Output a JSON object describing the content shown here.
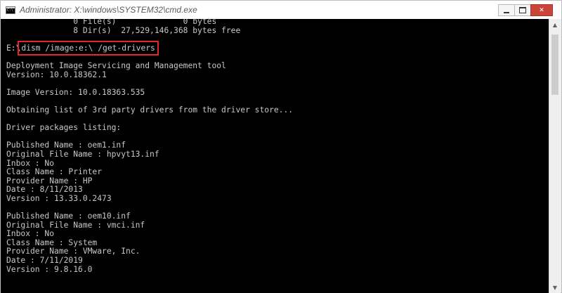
{
  "window": {
    "title": "Administrator: X:\\windows\\SYSTEM32\\cmd.exe",
    "icon": "cmd-icon",
    "controls": {
      "minimize_icon": "minimize-icon",
      "maximize_icon": "maximize-icon",
      "close_icon": "close-icon",
      "close_glyph": "✕"
    }
  },
  "console": {
    "lines": [
      "              0 File(s)              0 bytes",
      "              8 Dir(s)  27,529,146,368 bytes free",
      "",
      "",
      "",
      "Deployment Image Servicing and Management tool",
      "Version: 10.0.18362.1",
      "",
      "Image Version: 10.0.18363.535",
      "",
      "Obtaining list of 3rd party drivers from the driver store...",
      "",
      "Driver packages listing:",
      "",
      "Published Name : oem1.inf",
      "Original File Name : hpvyt13.inf",
      "Inbox : No",
      "Class Name : Printer",
      "Provider Name : HP",
      "Date : 8/11/2013",
      "Version : 13.33.0.2473",
      "",
      "Published Name : oem10.inf",
      "Original File Name : vmci.inf",
      "Inbox : No",
      "Class Name : System",
      "Provider Name : VMware, Inc.",
      "Date : 7/11/2019",
      "Version : 9.8.16.0"
    ],
    "prompt": "E:\\",
    "command": "dism /image:e:\\ /get-drivers",
    "highlight_color": "#e3262b",
    "background": "#000000",
    "text_color": "#c8c8c8"
  },
  "scrollbar": {
    "up_arrow": "▲",
    "down_arrow": "▼"
  }
}
